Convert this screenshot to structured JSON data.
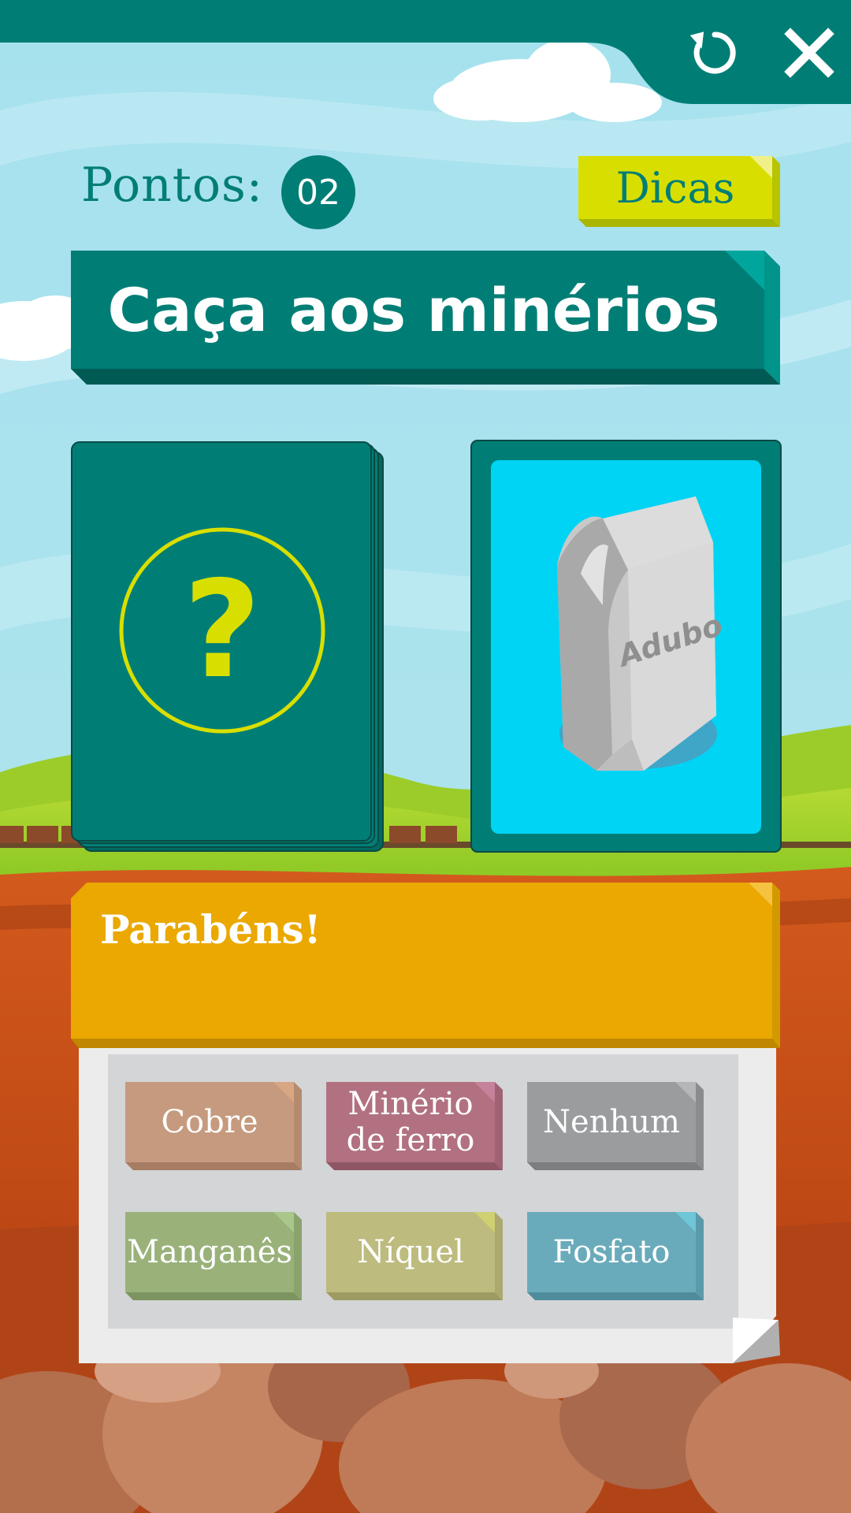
{
  "header": {
    "reload_icon": "reload-icon",
    "close_icon": "close-icon"
  },
  "score": {
    "label": "Pontos:",
    "value": "02"
  },
  "hints": {
    "label": "Dicas"
  },
  "game": {
    "title": "Caça aos minérios",
    "deck_symbol": "?",
    "card_product_label": "Adubo"
  },
  "feedback": {
    "message": "Parabéns!"
  },
  "options": [
    {
      "label": "Cobre",
      "color": "#c69a7e",
      "fold": "#d9a683"
    },
    {
      "label": "Minério\nde ferro",
      "color": "#b27180",
      "fold": "#c6829a"
    },
    {
      "label": "Nenhum",
      "color": "#9a9c9d",
      "fold": "#b4b6b7"
    },
    {
      "label": "Manganês",
      "color": "#9ab27a",
      "fold": "#a9c78a"
    },
    {
      "label": "Níquel",
      "color": "#bdbb7e",
      "fold": "#cfd072"
    },
    {
      "label": "Fosfato",
      "color": "#6aabbb",
      "fold": "#6ec6d6"
    }
  ],
  "colors": {
    "teal": "#007e76",
    "yellow_accent": "#d8df00",
    "card_blue": "#00d4f5",
    "feedback_orange": "#eaa800"
  }
}
